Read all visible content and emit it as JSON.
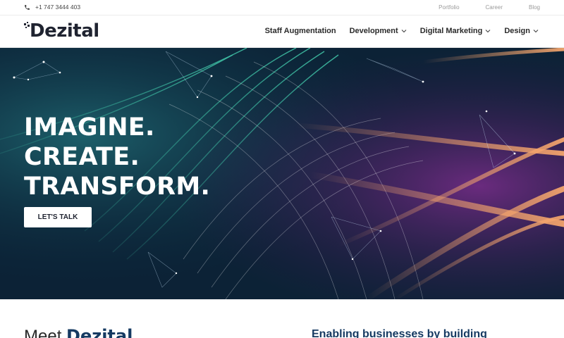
{
  "topbar": {
    "phone": "+1 747 3444 403",
    "links": [
      "Portfolio",
      "Career",
      "Blog"
    ]
  },
  "header": {
    "logo_text": "Dezital",
    "nav": [
      {
        "label": "Staff Augmentation",
        "has_dropdown": false
      },
      {
        "label": "Development",
        "has_dropdown": true
      },
      {
        "label": "Digital Marketing",
        "has_dropdown": true
      },
      {
        "label": "Design",
        "has_dropdown": true
      }
    ]
  },
  "hero": {
    "lines": [
      "IMAGINE.",
      "CREATE.",
      "TRANSFORM."
    ],
    "cta_label": "LET'S TALK"
  },
  "section": {
    "meet_prefix": "Meet",
    "meet_brand": "Dezital",
    "enabling": "Enabling businesses by building"
  },
  "colors": {
    "brand_dark": "#1f2330",
    "accent_blue": "#163a62",
    "hero_bg": "#0b2a3e",
    "hero_teal": "#3fc1a5",
    "hero_orange": "#f3a46c",
    "hero_purple": "#5a2a78"
  },
  "icons": {
    "phone": "phone-icon",
    "dropdown": "chevron-down-icon"
  }
}
